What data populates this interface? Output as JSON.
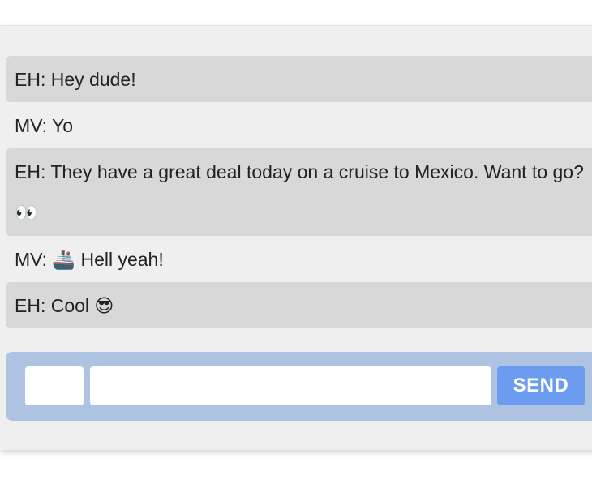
{
  "messages": [
    {
      "text": "EH: Hey dude!",
      "shaded": true
    },
    {
      "text": "MV: Yo",
      "shaded": false
    },
    {
      "text": "EH: They have a great deal today on a cruise to Mexico. Want to go? 👀",
      "shaded": true
    },
    {
      "text": "MV: 🚢 Hell yeah!",
      "shaded": false
    },
    {
      "text": "EH: Cool 😎",
      "shaded": true
    }
  ],
  "composer": {
    "name_value": "",
    "message_value": "",
    "send_label": "SEND"
  },
  "colors": {
    "panel_bg": "#efefef",
    "shaded_message_bg": "#d8d8d8",
    "composer_bg": "#aec3e1",
    "send_button_bg": "#6b9cf0"
  }
}
